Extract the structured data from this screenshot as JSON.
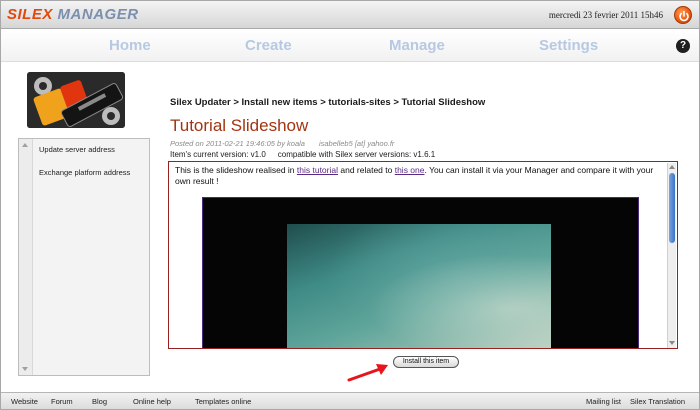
{
  "app": {
    "logo_primary": "SILEX",
    "logo_secondary": "MANAGER",
    "datetime": "mercredi 23 fevrier 2011 15h46"
  },
  "nav": {
    "items": [
      "Home",
      "Create",
      "Manage",
      "Settings"
    ],
    "help_label": "?"
  },
  "sidebar": {
    "badge_text": "Silex Updater",
    "links": [
      "Update server address",
      "Exchange platform address"
    ]
  },
  "content": {
    "breadcrumb": "Silex Updater > Install new items > tutorials-sites > Tutorial Slideshow",
    "title": "Tutorial Slideshow",
    "posted": "Posted on 2011-02-21 19:46:05 by koala",
    "email": "isabelleb5 [at] yahoo.fr",
    "version": "Item's current version: v1.0",
    "compatibility": "compatible with Silex server versions: v1.6.1",
    "desc_before": "This is the slideshow realised in ",
    "desc_link1": "this tutorial",
    "desc_middle": " and related to ",
    "desc_link2": "this one",
    "desc_after": ". You can install it via your Manager and compare it with your own result !",
    "install_label": "Install this item"
  },
  "footer": {
    "left": [
      "Website",
      "Forum",
      "Blog",
      "Online help",
      "Templates online"
    ],
    "right": [
      "Mailing list",
      "Silex Translation"
    ]
  },
  "colors": {
    "accent": "#e0490f",
    "title": "#a33411",
    "nav": "#b7c9e2",
    "link": "#5b2a86"
  }
}
